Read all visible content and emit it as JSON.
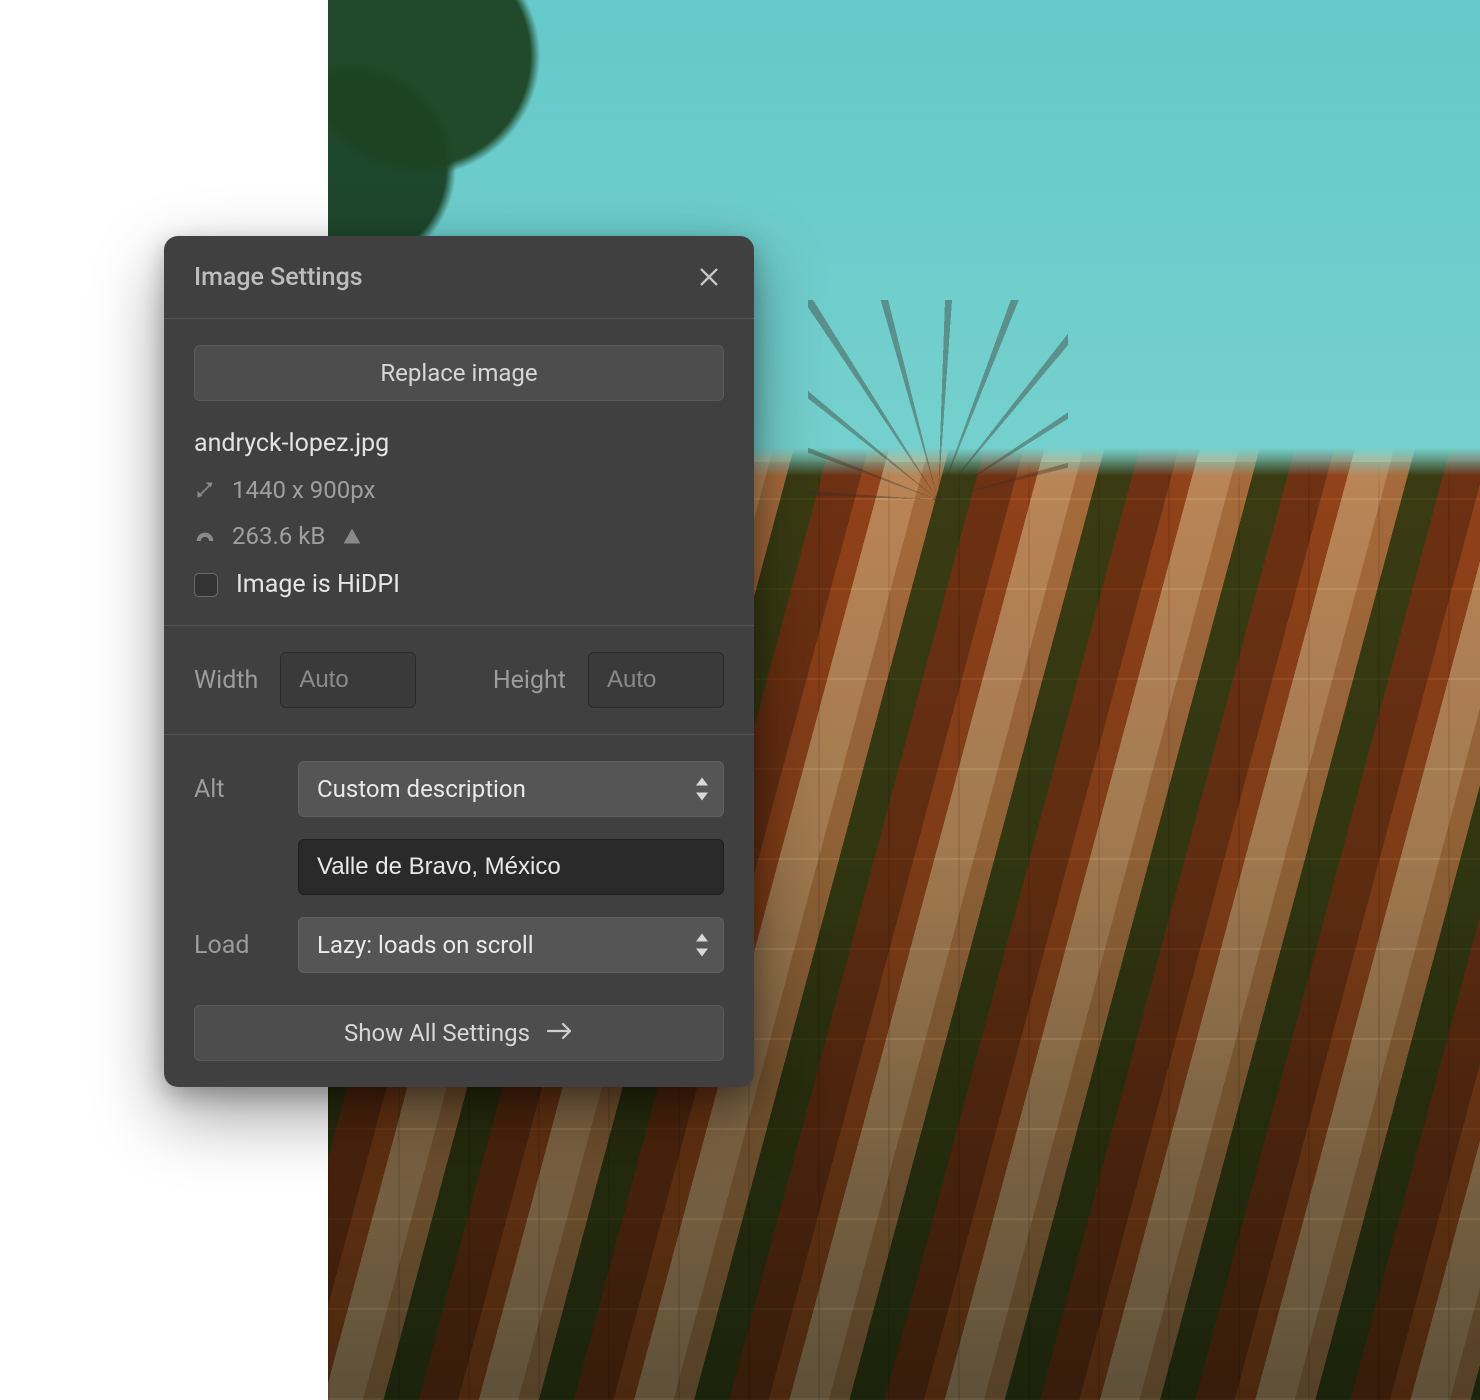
{
  "panel": {
    "title": "Image Settings",
    "replace_label": "Replace image",
    "filename": "andryck-lopez.jpg",
    "dimensions": "1440 x 900px",
    "filesize": "263.6 kB",
    "hidpi_label": "Image is HiDPI",
    "width_label": "Width",
    "width_placeholder": "Auto",
    "height_label": "Height",
    "height_placeholder": "Auto",
    "alt_label": "Alt",
    "alt_mode": "Custom description",
    "alt_value": "Valle de Bravo, México",
    "load_label": "Load",
    "load_mode": "Lazy: loads on scroll",
    "show_all_label": "Show All Settings"
  }
}
